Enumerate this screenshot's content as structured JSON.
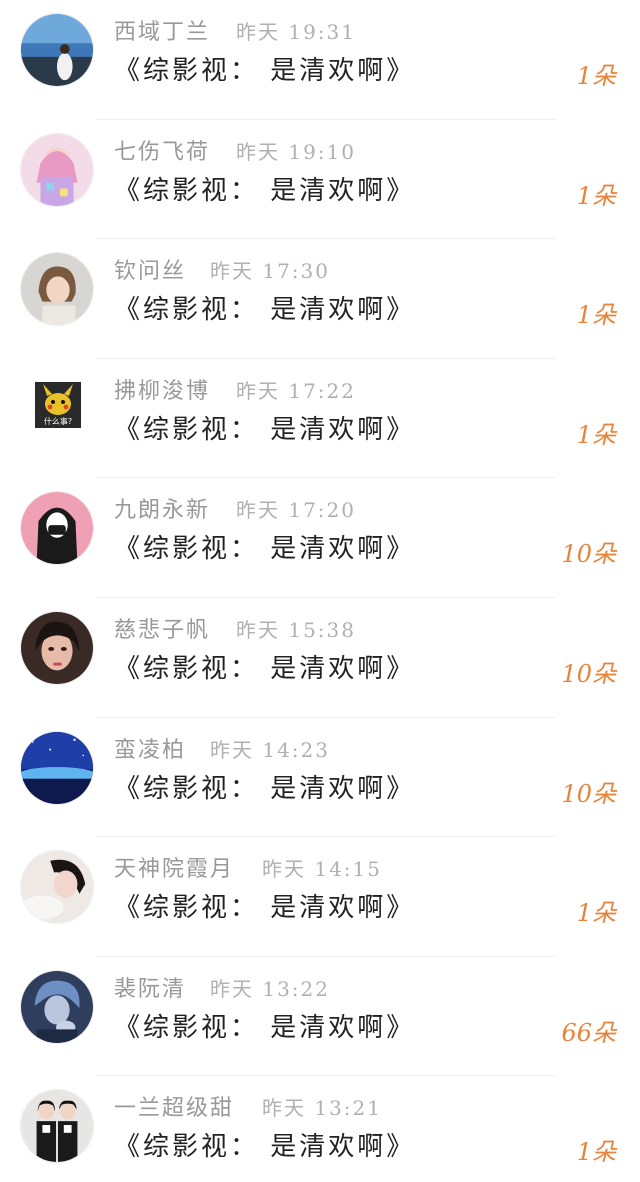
{
  "gift_list": {
    "accent_color": "#e8843a",
    "items": [
      {
        "name": "西域丁兰",
        "time": "昨天 19:31",
        "message": "《综影视： 是清欢啊》",
        "count": "1朵",
        "avatar": "seaside-girl-avatar"
      },
      {
        "name": "七伤飞荷",
        "time": "昨天 19:10",
        "message": "《综影视： 是清欢啊》",
        "count": "1朵",
        "avatar": "pink-anime-girl-avatar"
      },
      {
        "name": "钦问丝",
        "time": "昨天 17:30",
        "message": "《综影视： 是清欢啊》",
        "count": "1朵",
        "avatar": "short-hair-girl-avatar"
      },
      {
        "name": "拂柳浚博",
        "time": "昨天 17:22",
        "message": "《综影视： 是清欢啊》",
        "count": "1朵",
        "avatar": "pikachu-avatar",
        "avatar_caption": "什么事?"
      },
      {
        "name": "九朗永新",
        "time": "昨天 17:20",
        "message": "《综影视： 是清欢啊》",
        "count": "10朵",
        "avatar": "masked-girl-avatar"
      },
      {
        "name": "慈悲子帆",
        "time": "昨天 15:38",
        "message": "《综影视： 是清欢啊》",
        "count": "10朵",
        "avatar": "girl-selfie-avatar"
      },
      {
        "name": "蛮凌柏",
        "time": "昨天 14:23",
        "message": "《综影视： 是清欢啊》",
        "count": "10朵",
        "avatar": "night-sky-avatar"
      },
      {
        "name": "天神院霞月",
        "time": "昨天 14:15",
        "message": "《综影视： 是清欢啊》",
        "count": "1朵",
        "avatar": "lying-girl-avatar"
      },
      {
        "name": "裴阮清",
        "time": "昨天 13:22",
        "message": "《综影视： 是清欢啊》",
        "count": "66朵",
        "avatar": "blue-boy-avatar"
      },
      {
        "name": "一兰超级甜",
        "time": "昨天 13:21",
        "message": "《综影视： 是清欢啊》",
        "count": "1朵",
        "avatar": "couple-avatar"
      }
    ]
  }
}
